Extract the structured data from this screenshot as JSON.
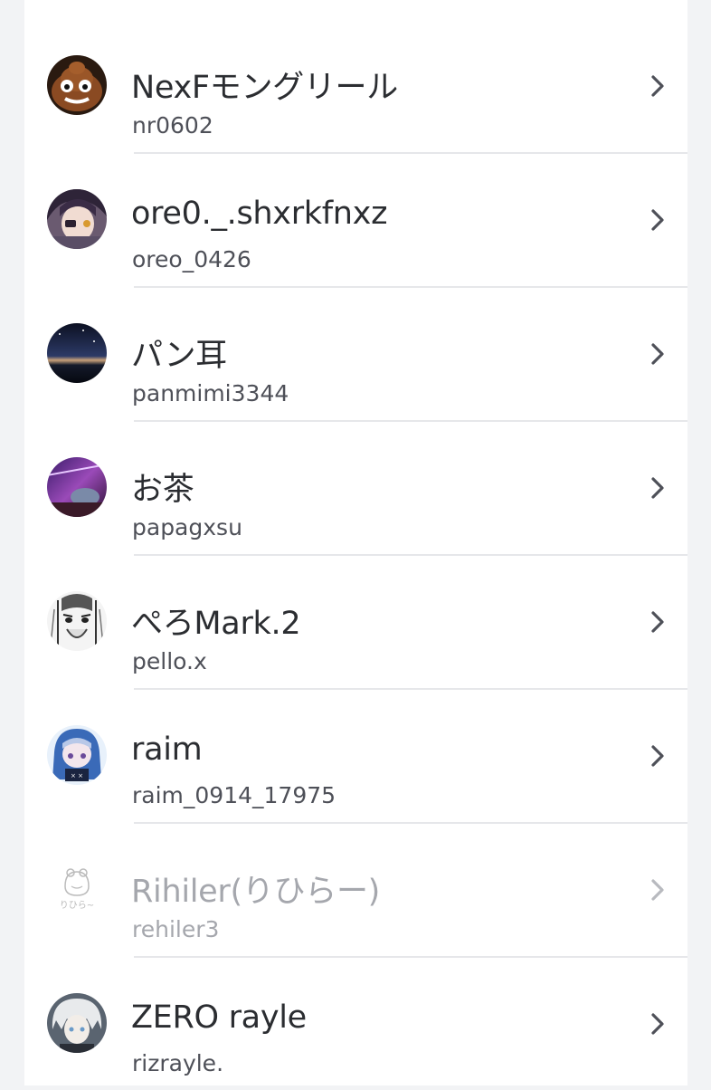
{
  "friends": [
    {
      "display_name": "NexFモングリール",
      "username": "nr0602",
      "avatar": "poop-face-avatar",
      "dim": false
    },
    {
      "display_name": "ore0._.shxrkfnxz",
      "username": "oreo_0426",
      "avatar": "anime-girl-purple-avatar",
      "dim": false
    },
    {
      "display_name": "パン耳",
      "username": "panmimi3344",
      "avatar": "night-sky-avatar",
      "dim": false
    },
    {
      "display_name": "お茶",
      "username": "papagxsu",
      "avatar": "purple-space-avatar",
      "dim": false
    },
    {
      "display_name": "ぺろMark.2",
      "username": "pello.x",
      "avatar": "manga-sketch-avatar",
      "dim": false
    },
    {
      "display_name": "raim",
      "username": "raim_0914_17975",
      "avatar": "anime-blue-hood-avatar",
      "dim": false
    },
    {
      "display_name": "Rihiler(りひらー)",
      "username": "rehiler3",
      "avatar": "frog-doodle-avatar",
      "dim": true,
      "avatar_text": "りひら~"
    },
    {
      "display_name": "ZERO rayle",
      "username": "rizrayle.",
      "avatar": "white-hair-anime-avatar",
      "dim": false
    }
  ],
  "icons": {
    "row_action": "chevron-right-icon"
  },
  "colors": {
    "name": "#2b2d31",
    "handle": "#4e5058",
    "dimmed": "#a5a7ad",
    "divider": "#e6e7ea"
  }
}
